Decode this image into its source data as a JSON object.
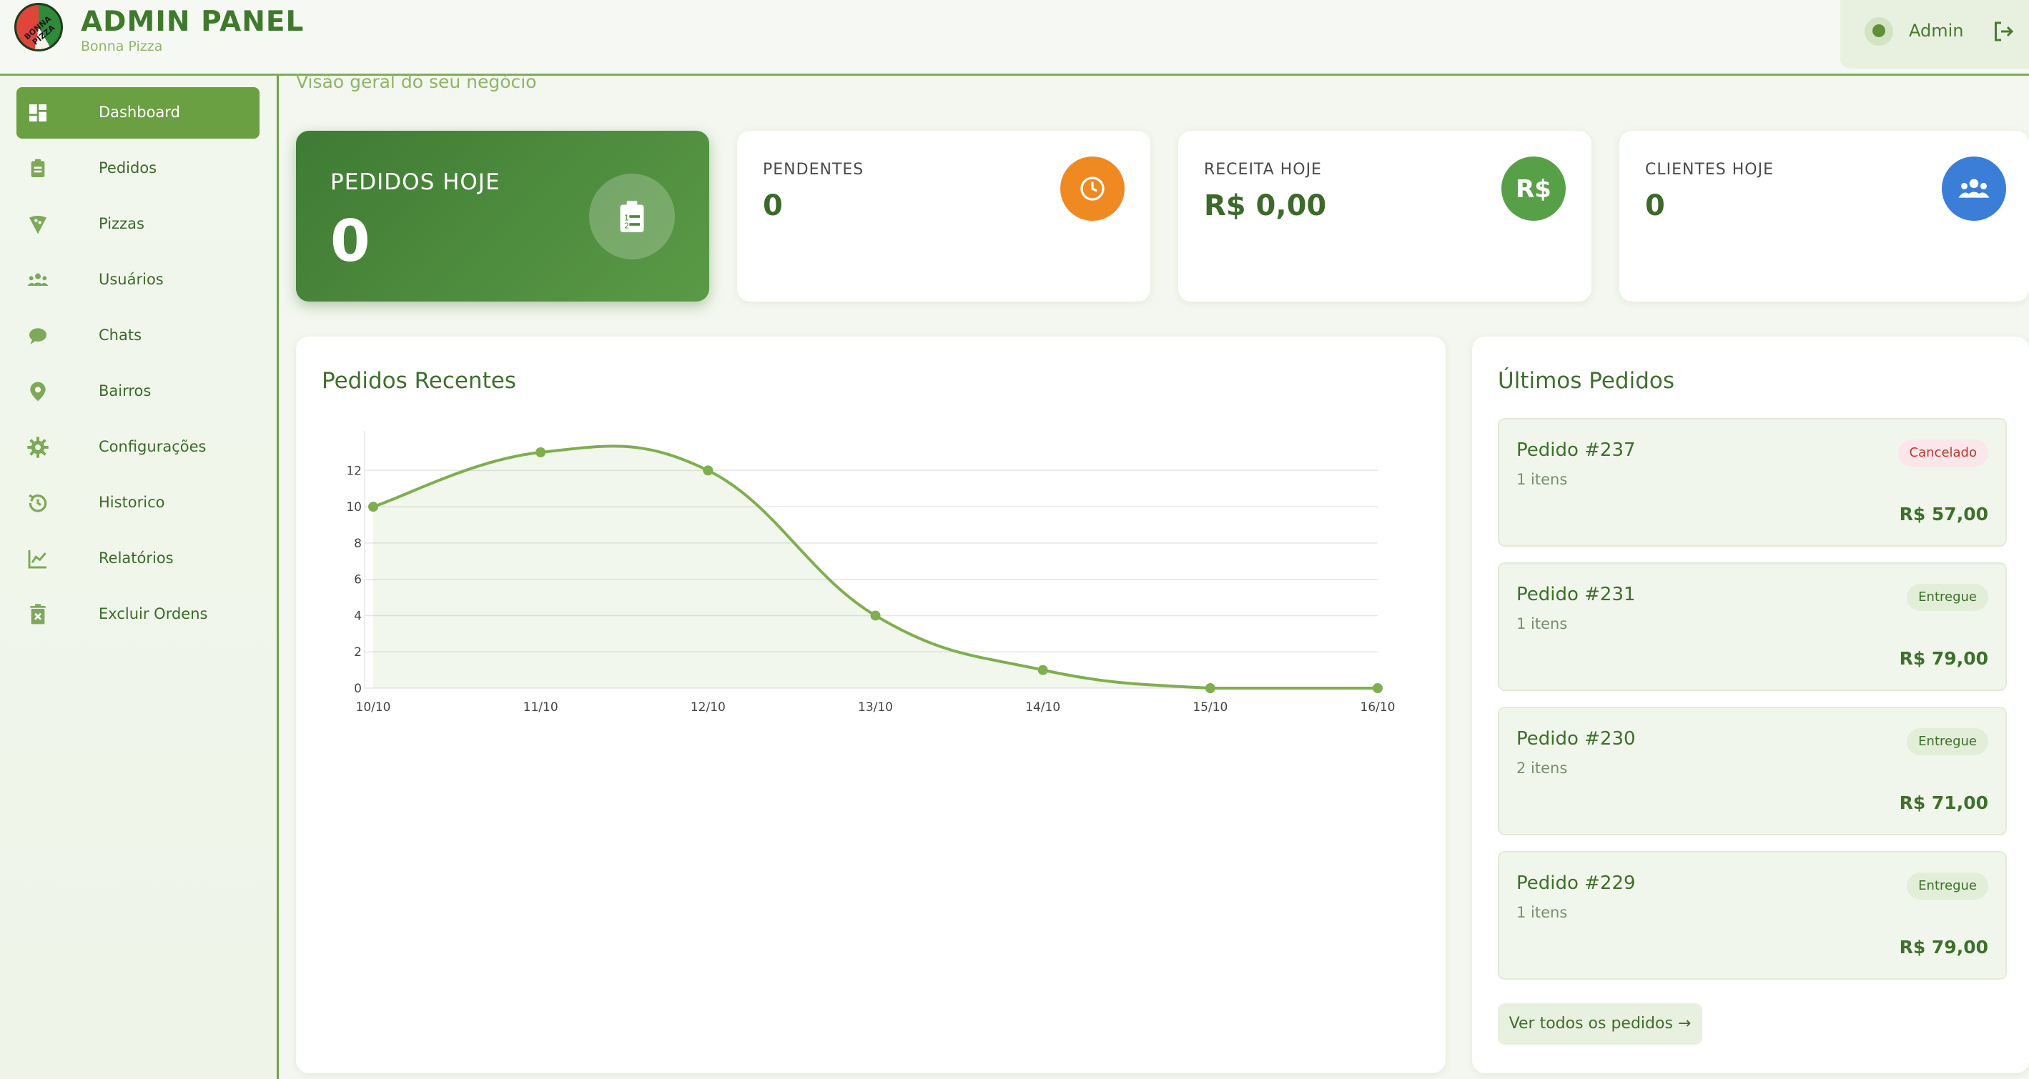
{
  "header": {
    "title": "ADMIN PANEL",
    "subtitle": "Bonna Pizza",
    "logo_text": "BONNA PIZZA",
    "user_name": "Admin"
  },
  "sidebar": {
    "items": [
      {
        "label": "Dashboard",
        "icon": "dashboard-icon",
        "active": true
      },
      {
        "label": "Pedidos",
        "icon": "clipboard-icon"
      },
      {
        "label": "Pizzas",
        "icon": "pizza-icon"
      },
      {
        "label": "Usuários",
        "icon": "users-icon"
      },
      {
        "label": "Chats",
        "icon": "chat-icon"
      },
      {
        "label": "Bairros",
        "icon": "location-pin-icon"
      },
      {
        "label": "Configurações",
        "icon": "gear-icon"
      },
      {
        "label": "Historico",
        "icon": "history-icon"
      },
      {
        "label": "Relatórios",
        "icon": "chart-line-icon"
      },
      {
        "label": "Excluir Ordens",
        "icon": "trash-icon"
      }
    ]
  },
  "main": {
    "subtitle": "Visão geral do seu negócio",
    "cards": [
      {
        "label": "PEDIDOS HOJE",
        "value": "0",
        "icon": "clipboard-list-icon"
      },
      {
        "label": "PENDENTES",
        "value": "0",
        "icon": "clock-icon",
        "color": "#ef8a23"
      },
      {
        "label": "RECEITA HOJE",
        "value": "R$ 0,00",
        "icon_text": "R$",
        "color": "#58a047"
      },
      {
        "label": "CLIENTES HOJE",
        "value": "0",
        "icon": "users-icon",
        "color": "#3a7ed8"
      }
    ],
    "chart_panel": {
      "title": "Pedidos Recentes"
    },
    "orders_panel": {
      "title": "Últimos Pedidos",
      "orders": [
        {
          "id": "Pedido #237",
          "items": "1 itens",
          "total": "R$ 57,00",
          "status": "Cancelado"
        },
        {
          "id": "Pedido #231",
          "items": "1 itens",
          "total": "R$ 79,00",
          "status": "Entregue"
        },
        {
          "id": "Pedido #230",
          "items": "2 itens",
          "total": "R$ 71,00",
          "status": "Entregue"
        },
        {
          "id": "Pedido #229",
          "items": "1 itens",
          "total": "R$ 79,00",
          "status": "Entregue"
        }
      ],
      "view_all": "Ver todos os pedidos →"
    }
  },
  "chart_data": {
    "type": "line",
    "categories": [
      "10/10",
      "11/10",
      "12/10",
      "13/10",
      "14/10",
      "15/10",
      "16/10"
    ],
    "series": [
      {
        "values": [
          10,
          13,
          12,
          4,
          1,
          0,
          0
        ]
      }
    ],
    "yticks": [
      0,
      2,
      4,
      6,
      8,
      10,
      12
    ],
    "ylim": [
      0,
      13
    ],
    "title": "",
    "xlabel": "",
    "ylabel": "",
    "grid": true,
    "color": "#7fae4e"
  }
}
